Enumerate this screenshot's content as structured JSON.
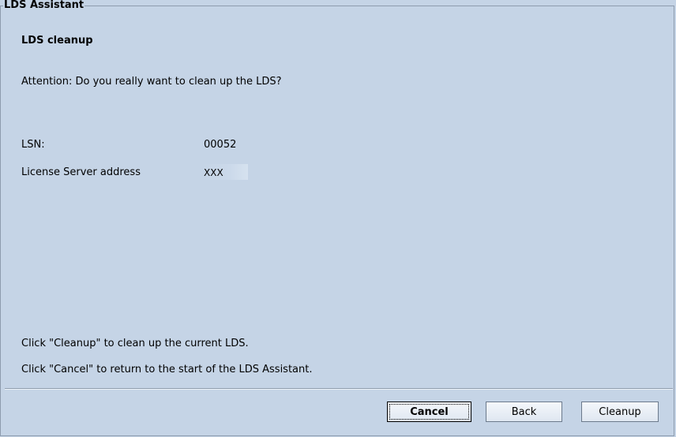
{
  "window": {
    "title": "LDS Assistant"
  },
  "page": {
    "heading": "LDS cleanup",
    "question": "Attention: Do you really want to clean up the LDS?"
  },
  "fields": {
    "lsn_label": "LSN:",
    "lsn_value": "00052",
    "address_label": "License Server address",
    "address_value": "XXX"
  },
  "instructions": {
    "line1": "Click \"Cleanup\" to clean up the current LDS.",
    "line2": "Click \"Cancel\" to return to the start of the LDS Assistant."
  },
  "buttons": {
    "cancel": "Cancel",
    "back": "Back",
    "cleanup": "Cleanup"
  }
}
